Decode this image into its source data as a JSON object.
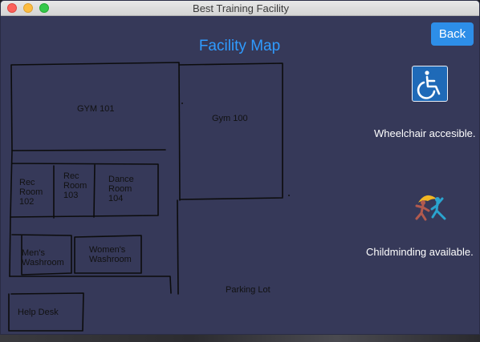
{
  "window": {
    "title": "Best Training Facility"
  },
  "header": {
    "back_label": "Back",
    "map_title": "Facility Map"
  },
  "map": {
    "rooms": {
      "gym101": "GYM 101",
      "gym100": "Gym 100",
      "rec102": [
        "Rec",
        "Room",
        "102"
      ],
      "rec103": [
        "Rec",
        "Room",
        "103"
      ],
      "dance104": [
        "Dance",
        "Room",
        "104"
      ],
      "mens": [
        "Men's",
        "Washroom"
      ],
      "womens": [
        "Women's",
        "Washroom"
      ],
      "parking": "Parking Lot",
      "helpdesk": "Help Desk"
    }
  },
  "accessibility": {
    "wheelchair_icon": "wheelchair-icon",
    "wheelchair_caption": "Wheelchair accesible.",
    "childminding_icon": "children-playing-icon",
    "childminding_caption": "Childminding available."
  },
  "colors": {
    "background": "#363959",
    "accent": "#2f9bff",
    "button": "#2d8ee8"
  }
}
